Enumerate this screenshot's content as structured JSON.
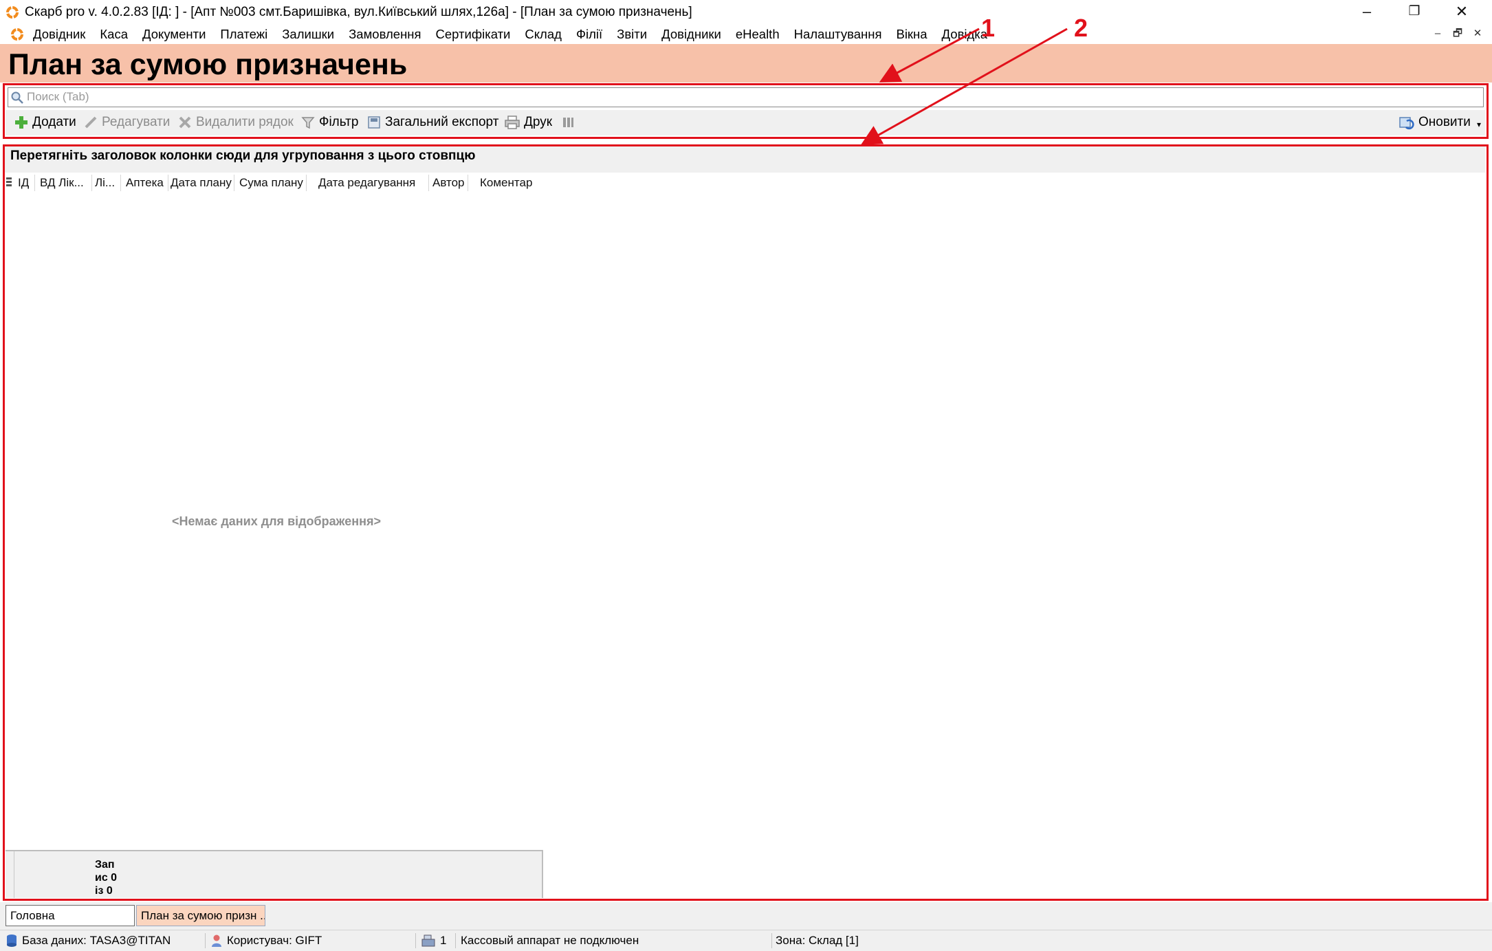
{
  "window": {
    "title": "Скарб pro v. 4.0.2.83 [ІД:       ] - [Апт №003 смт.Баришівка, вул.Київський шлях,126а] - [План за сумою призначень]",
    "controls": {
      "minimize": "–",
      "restore": "❐",
      "close": "✕"
    }
  },
  "menu": {
    "items": [
      "Довідник",
      "Каса",
      "Документи",
      "Платежі",
      "Залишки",
      "Замовлення",
      "Сертифікати",
      "Склад",
      "Філії",
      "Звіти",
      "Довідники",
      "eHealth",
      "Налаштування",
      "Вікна",
      "Довідка"
    ],
    "mdi_controls": {
      "minimize": "–",
      "restore": "🗗",
      "close": "✕"
    }
  },
  "header": {
    "title": "План за сумою призначень"
  },
  "search": {
    "placeholder": "Поиск (Tab)"
  },
  "toolbar": {
    "add": "Додати",
    "edit": "Редагувати",
    "delete": "Видалити рядок",
    "filter": "Фільтр",
    "export": "Загальний експорт",
    "print": "Друк",
    "refresh": "Оновити"
  },
  "grid": {
    "group_panel_text": "Перетягніть заголовок колонки сюди для угруповання з цього стовпцю",
    "columns": [
      "ІД",
      "ВД Лік...",
      "Лі...",
      "Аптека",
      "Дата плану",
      "Сума плану",
      "Дата редагування",
      "Автор",
      "Коментар"
    ],
    "no_data_text": "<Немає даних для відображення>",
    "footer_summary": "Зап ис 0 із 0"
  },
  "tabs": [
    {
      "label": "Головна",
      "active": false
    },
    {
      "label": "План за сумою призн ...",
      "active": true
    }
  ],
  "status": {
    "database": "База даних: TASA3@TITAN",
    "user": "Користувач: GIFT",
    "register_count": "1",
    "register_status": "Кассовый аппарат не подключен",
    "zone": "Зона: Склад [1]"
  },
  "annotations": {
    "label_1": "1",
    "label_2": "2"
  },
  "colors": {
    "header_bg": "#f7c1a9",
    "annotation_red": "#e1111b",
    "active_tab_bg": "#fbd5bf"
  }
}
